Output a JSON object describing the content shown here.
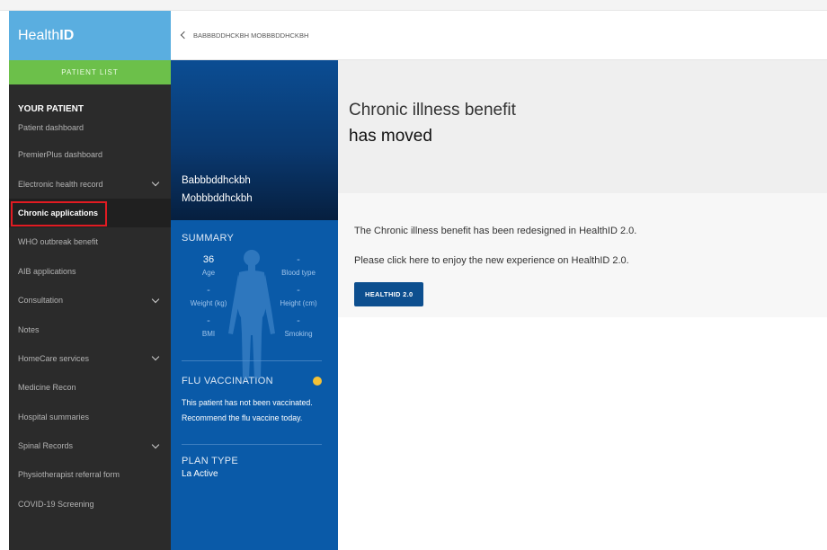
{
  "brand": {
    "name_light": "Health",
    "name_bold": "ID"
  },
  "sidebar": {
    "patient_list": "PATIENT LIST",
    "section_title": "YOUR PATIENT",
    "items": [
      {
        "label": "Patient dashboard",
        "has_chevron": false,
        "active": false
      },
      {
        "label": "PremierPlus dashboard",
        "has_chevron": false,
        "active": false
      },
      {
        "label": "Electronic health record",
        "has_chevron": true,
        "active": false
      },
      {
        "label": "Chronic applications",
        "has_chevron": false,
        "active": true
      },
      {
        "label": "WHO outbreak benefit",
        "has_chevron": false,
        "active": false
      },
      {
        "label": "AIB applications",
        "has_chevron": false,
        "active": false
      },
      {
        "label": "Consultation",
        "has_chevron": true,
        "active": false
      },
      {
        "label": "Notes",
        "has_chevron": false,
        "active": false
      },
      {
        "label": "HomeCare services",
        "has_chevron": true,
        "active": false
      },
      {
        "label": "Medicine Recon",
        "has_chevron": false,
        "active": false
      },
      {
        "label": "Hospital summaries",
        "has_chevron": false,
        "active": false
      },
      {
        "label": "Spinal Records",
        "has_chevron": true,
        "active": false
      },
      {
        "label": "Physiotherapist referral form",
        "has_chevron": false,
        "active": false
      },
      {
        "label": "COVID-19 Screening",
        "has_chevron": false,
        "active": false
      }
    ]
  },
  "patient": {
    "breadcrumb": "BABBBDDHCKBH MOBBBDDHCKBH",
    "first_name": "Babbbddhckbh",
    "last_name": "Mobbbddhckbh",
    "summary_title": "SUMMARY",
    "stats": {
      "age": {
        "value": "36",
        "label": "Age"
      },
      "blood_type": {
        "value": "-",
        "label": "Blood type"
      },
      "weight": {
        "value": "-",
        "label": "Weight (kg)"
      },
      "height": {
        "value": "-",
        "label": "Height (cm)"
      },
      "bmi": {
        "value": "-",
        "label": "BMI"
      },
      "smoking": {
        "value": "-",
        "label": "Smoking"
      }
    },
    "flu_title": "FLU VACCINATION",
    "flu_status_color": "#f4c136",
    "flu_message": "This patient has not been vaccinated. Recommend the flu vaccine today.",
    "plan_title": "PLAN TYPE",
    "plan_value": "La Active"
  },
  "main": {
    "title_line1": "Chronic illness benefit",
    "title_line2": "has moved",
    "message1": "The Chronic illness benefit has been redesigned in HealthID 2.0.",
    "message2": "Please click here to enjoy the new experience on HealthID 2.0.",
    "button_label": "HEALTHID 2.0"
  },
  "colors": {
    "brand_blue": "#5aaee0",
    "patient_list_green": "#6cc04a",
    "panel_blue": "#0a5aa8",
    "button_blue": "#0d4f8f",
    "highlight_red": "#e11b22"
  }
}
